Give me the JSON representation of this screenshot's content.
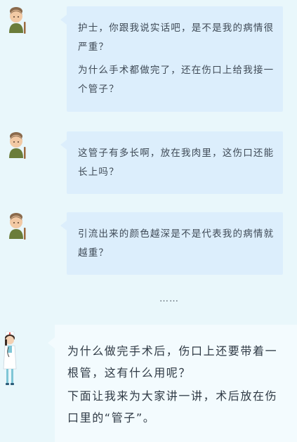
{
  "messages": [
    {
      "avatar": "elderly-patient-avatar",
      "lines": [
        "护士，你跟我说实话吧，是不是我的病情很严重？",
        "为什么手术都做完了，还在伤口上给我接一个管子？"
      ]
    },
    {
      "avatar": "elderly-patient-avatar",
      "lines": [
        "这管子有多长啊，放在我肉里，这伤口还能长上吗？"
      ]
    },
    {
      "avatar": "elderly-patient-avatar",
      "lines": [
        "引流出来的颜色越深是不是代表我的病情就越重？"
      ]
    }
  ],
  "ellipsis": "……",
  "nurse_message": {
    "avatar": "nurse-avatar",
    "lines": [
      "为什么做完手术后，伤口上还要带着一根管，这有什么用呢？",
      "下面让我来为大家讲一讲，术后放在伤口里的“管子”。"
    ]
  },
  "colors": {
    "background": "#e9f7fb",
    "patient_bubble": "#dceefc",
    "nurse_bubble": "#f3fbfe",
    "text": "#3f4a56"
  }
}
